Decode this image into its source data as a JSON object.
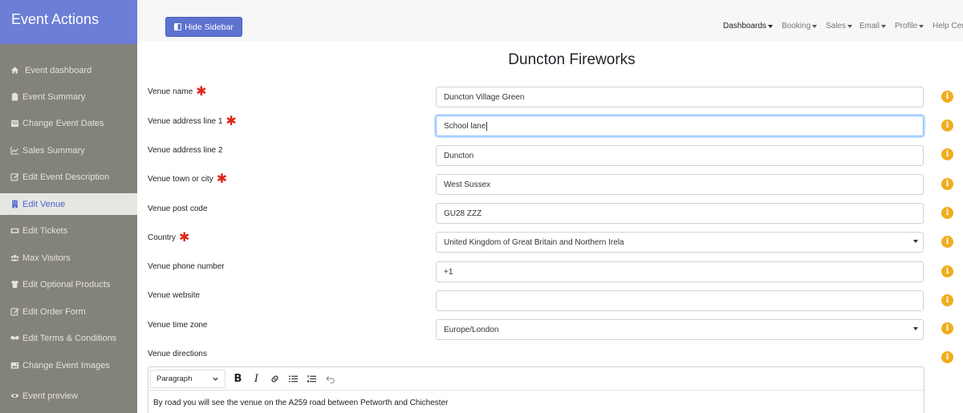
{
  "sidebar": {
    "title": "Event Actions",
    "items": [
      {
        "label": "Event dashboard",
        "icon": "home-icon"
      },
      {
        "label": "Event Summary",
        "icon": "clipboard-icon"
      },
      {
        "label": "Change Event Dates",
        "icon": "calendar-icon"
      },
      {
        "label": "Sales Summary",
        "icon": "chart-icon"
      },
      {
        "label": "Edit Event Description",
        "icon": "edit-icon"
      },
      {
        "label": "Edit Venue",
        "icon": "building-icon"
      },
      {
        "label": "Edit Tickets",
        "icon": "ticket-icon"
      },
      {
        "label": "Max Visitors",
        "icon": "users-icon"
      },
      {
        "label": "Edit Optional Products",
        "icon": "tshirt-icon"
      },
      {
        "label": "Edit Order Form",
        "icon": "edit-icon"
      },
      {
        "label": "Edit Terms & Conditions",
        "icon": "handshake-icon"
      },
      {
        "label": "Change Event Images",
        "icon": "image-icon"
      },
      {
        "label": "Event preview",
        "icon": "eye-icon"
      }
    ]
  },
  "topbar": {
    "hide_sidebar_label": "Hide Sidebar",
    "nav": {
      "dashboards": "Dashboards",
      "booking": "Booking",
      "sales": "Sales",
      "email": "Email",
      "profile": "Profile",
      "help": "Help Cer"
    }
  },
  "page": {
    "title": "Duncton Fireworks"
  },
  "form": {
    "venue_name": {
      "label": "Venue name",
      "value": "Duncton Village Green"
    },
    "address1": {
      "label": "Venue address line 1",
      "value": "School lane"
    },
    "address2": {
      "label": "Venue address line 2",
      "value": "Duncton"
    },
    "town": {
      "label": "Venue town or city",
      "value": "West Sussex"
    },
    "postcode": {
      "label": "Venue post code",
      "value": "GU28 ZZZ"
    },
    "country": {
      "label": "Country",
      "value": "United Kingdom of Great Britain and Northern Irela"
    },
    "phone": {
      "label": "Venue phone number",
      "value": "+1"
    },
    "website": {
      "label": "Venue website",
      "value": ""
    },
    "timezone": {
      "label": "Venue time zone",
      "value": "Europe/London"
    },
    "directions": {
      "label": "Venue directions",
      "format": "Paragraph",
      "text": "By road you will see the venue on the A259 road between Petworth and Chichester"
    }
  },
  "colors": {
    "sidebar_bg": "#84837a",
    "sidebar_header": "#6c7ed6",
    "accent": "#5e72d0",
    "required_star": "#e0261c",
    "info_icon": "#f0ad1d"
  }
}
